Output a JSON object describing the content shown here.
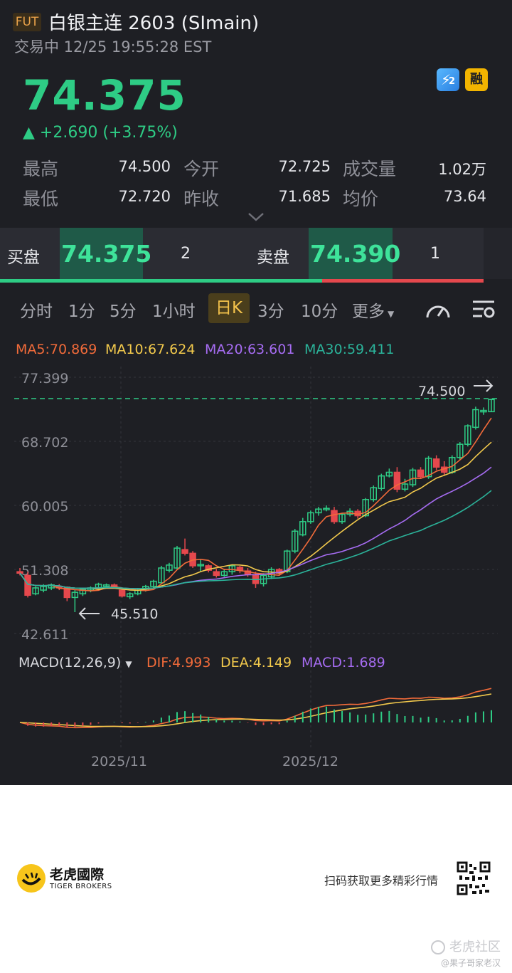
{
  "header": {
    "badge": "FUT",
    "title": "白银主连 2603 (SImain)",
    "status": "交易中 12/25 19:55:28 EST",
    "price": "74.375",
    "change": "▲ +2.690 (+3.75%)",
    "badge_lightning": "2",
    "badge_rong": "融"
  },
  "stats": [
    {
      "label": "最高",
      "value": "74.500"
    },
    {
      "label": "今开",
      "value": "72.725"
    },
    {
      "label": "成交量",
      "value": "1.02万"
    },
    {
      "label": "最低",
      "value": "72.720"
    },
    {
      "label": "昨收",
      "value": "71.685"
    },
    {
      "label": "均价",
      "value": "73.64"
    }
  ],
  "orderbook": {
    "bid_label": "买盘",
    "bid_price": "74.375",
    "bid_qty": "2",
    "ask_label": "卖盘",
    "ask_price": "74.390",
    "ask_qty": "1"
  },
  "tabs": [
    "分时",
    "1分",
    "5分",
    "1小时",
    "日K",
    "3分",
    "10分",
    "更多"
  ],
  "active_tab": "日K",
  "colors": {
    "up": "#2ecc85",
    "down": "#e5484d",
    "ma5": "#f26b3a",
    "ma10": "#f2c94c",
    "ma20": "#a66cf2",
    "ma30": "#2bb39a"
  },
  "ma_legend": {
    "ma5": "MA5:70.869",
    "ma10": "MA10:67.624",
    "ma20": "MA20:63.601",
    "ma30": "MA30:59.411"
  },
  "chart_data": {
    "type": "candlestick",
    "y_ticks": [
      "77.399",
      "68.702",
      "60.005",
      "51.308",
      "42.611"
    ],
    "ylim": [
      42.611,
      77.399
    ],
    "high_marker": "74.500",
    "low_marker": "45.510",
    "x_labels": [
      "2025/11",
      "2025/12"
    ],
    "candles": [
      [
        51.0,
        50.8,
        51.5,
        50.5
      ],
      [
        50.5,
        47.8,
        51.0,
        47.5
      ],
      [
        48.0,
        48.8,
        49.0,
        47.8
      ],
      [
        48.5,
        49.0,
        49.3,
        48.2
      ],
      [
        48.8,
        49.2,
        49.4,
        48.5
      ],
      [
        49.0,
        48.9,
        49.3,
        48.5
      ],
      [
        48.9,
        47.5,
        49.0,
        47.0
      ],
      [
        47.5,
        48.2,
        48.5,
        45.51
      ],
      [
        48.0,
        48.6,
        48.8,
        47.7
      ],
      [
        48.5,
        48.8,
        49.0,
        48.2
      ],
      [
        48.8,
        49.3,
        49.5,
        48.6
      ],
      [
        49.0,
        49.2,
        49.4,
        48.8
      ],
      [
        49.2,
        49.0,
        49.4,
        48.7
      ],
      [
        48.5,
        47.7,
        48.8,
        47.5
      ],
      [
        47.6,
        48.0,
        48.2,
        47.3
      ],
      [
        48.0,
        48.5,
        48.7,
        47.8
      ],
      [
        48.5,
        49.0,
        49.2,
        48.3
      ],
      [
        49.0,
        49.7,
        49.9,
        48.8
      ],
      [
        49.5,
        51.5,
        51.8,
        49.3
      ],
      [
        51.2,
        51.9,
        52.2,
        50.9
      ],
      [
        51.5,
        54.2,
        54.5,
        51.3
      ],
      [
        54.0,
        53.5,
        55.5,
        53.2
      ],
      [
        53.5,
        51.8,
        53.8,
        51.5
      ],
      [
        51.8,
        52.0,
        52.6,
        51.0
      ],
      [
        51.8,
        51.2,
        52.0,
        50.9
      ],
      [
        51.0,
        50.5,
        51.4,
        50.2
      ],
      [
        50.5,
        51.0,
        51.4,
        50.3
      ],
      [
        51.0,
        51.8,
        52.0,
        50.6
      ],
      [
        51.6,
        51.2,
        51.8,
        50.8
      ],
      [
        51.1,
        50.6,
        51.5,
        50.3
      ],
      [
        50.6,
        49.4,
        51.0,
        48.8
      ],
      [
        49.4,
        50.5,
        50.8,
        49.0
      ],
      [
        50.3,
        51.3,
        51.6,
        50.0
      ],
      [
        51.3,
        50.8,
        51.5,
        50.5
      ],
      [
        51.0,
        53.8,
        54.0,
        50.8
      ],
      [
        53.8,
        56.5,
        56.8,
        53.5
      ],
      [
        56.0,
        57.8,
        58.3,
        55.8
      ],
      [
        57.8,
        59.0,
        59.3,
        57.5
      ],
      [
        59.0,
        59.5,
        59.8,
        58.6
      ],
      [
        59.5,
        59.6,
        60.0,
        59.2
      ],
      [
        59.3,
        57.8,
        59.8,
        57.5
      ],
      [
        57.8,
        58.8,
        59.0,
        57.5
      ],
      [
        58.8,
        59.2,
        59.6,
        58.5
      ],
      [
        59.2,
        58.6,
        59.5,
        58.2
      ],
      [
        58.6,
        60.8,
        61.0,
        58.4
      ],
      [
        60.8,
        62.4,
        62.7,
        60.5
      ],
      [
        62.3,
        64.0,
        64.3,
        62.0
      ],
      [
        64.0,
        64.5,
        65.0,
        63.8
      ],
      [
        64.5,
        62.2,
        65.2,
        61.8
      ],
      [
        62.2,
        62.9,
        63.6,
        61.9
      ],
      [
        62.8,
        64.8,
        65.1,
        62.5
      ],
      [
        64.8,
        63.9,
        65.2,
        63.6
      ],
      [
        63.9,
        66.4,
        66.7,
        63.6
      ],
      [
        66.3,
        65.2,
        66.8,
        64.8
      ],
      [
        65.2,
        64.5,
        66.0,
        64.0
      ],
      [
        64.5,
        66.5,
        66.8,
        64.3
      ],
      [
        66.5,
        68.3,
        68.6,
        66.2
      ],
      [
        68.3,
        70.8,
        71.0,
        68.0
      ],
      [
        70.6,
        73.0,
        73.4,
        70.3
      ],
      [
        72.7,
        72.9,
        73.3,
        72.3
      ],
      [
        72.725,
        74.375,
        74.5,
        72.72
      ]
    ],
    "macd": {
      "label": "MACD(12,26,9)",
      "dif": "DIF:4.993",
      "dea": "DEA:4.149",
      "macd": "MACD:1.689"
    }
  },
  "footer": {
    "brand_cn": "老虎國際",
    "brand_en": "TIGER BROKERS",
    "scan_text": "扫码获取更多精彩行情",
    "watermark": "老虎社区",
    "watermark_user": "@果子哥家老汉"
  }
}
